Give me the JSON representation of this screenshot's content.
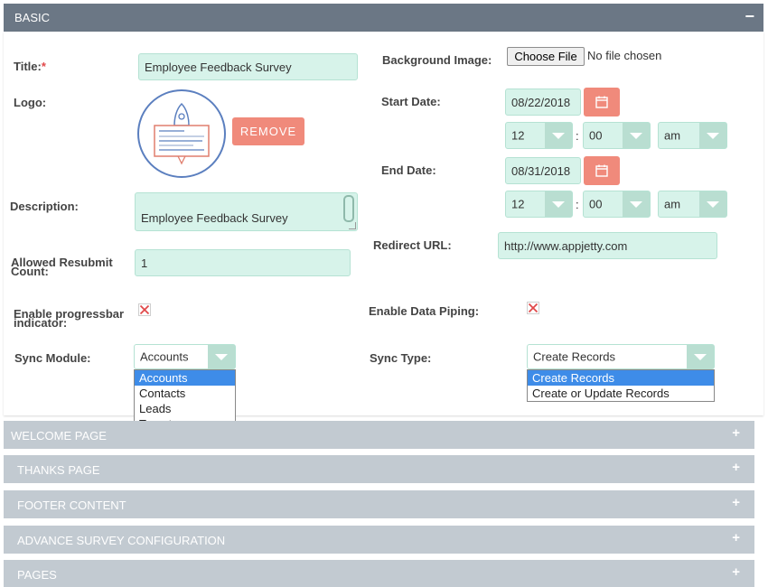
{
  "basic": {
    "title": "BASIC",
    "toggle": "−"
  },
  "form": {
    "title_label": "Title:",
    "title_required": "*",
    "title_value": "Employee Feedback Survey",
    "logo_label": "Logo:",
    "remove_label": "REMOVE",
    "description_label": "Description:",
    "description_value": "Employee Feedback Survey",
    "resubmit_label_1": "Allowed Resubmit",
    "resubmit_label_2": "Count:",
    "resubmit_value": "1",
    "progressbar_label_1": "Enable progressbar",
    "progressbar_label_2": "indicator:",
    "background_label": "Background Image:",
    "choose_file_label": "Choose File",
    "no_file_label": "No file chosen",
    "start_date_label": "Start Date:",
    "start_date_value": "08/22/2018",
    "start_hour": "12",
    "start_minute": "00",
    "start_ampm": "am",
    "end_date_label": "End Date:",
    "end_date_value": "08/31/2018",
    "end_hour": "12",
    "end_minute": "00",
    "end_ampm": "am",
    "time_separator": ":",
    "redirect_label": "Redirect URL:",
    "redirect_value": "http://www.appjetty.com",
    "data_piping_label": "Enable Data Piping:",
    "sync_module_label": "Sync Module:",
    "sync_module_value": "Accounts",
    "sync_module_options": [
      "Accounts",
      "Contacts",
      "Leads",
      "Targets"
    ],
    "sync_type_label": "Sync Type:",
    "sync_type_value": "Create Records",
    "sync_type_options": [
      "Create Records",
      "Create or Update Records"
    ]
  },
  "panels": [
    {
      "title": "WELCOME PAGE",
      "plus": "+"
    },
    {
      "title": "THANKS PAGE",
      "plus": "+"
    },
    {
      "title": "FOOTER CONTENT",
      "plus": "+"
    },
    {
      "title": "ADVANCE SURVEY CONFIGURATION",
      "plus": "+"
    },
    {
      "title": "PAGES",
      "plus": "+"
    }
  ],
  "colors": {
    "header": "#6b7785",
    "input_bg": "#d7f3ea",
    "accent_button": "#f08a7b",
    "panel": "#c2cad1",
    "dropdown_selected": "#3e8ce8"
  }
}
